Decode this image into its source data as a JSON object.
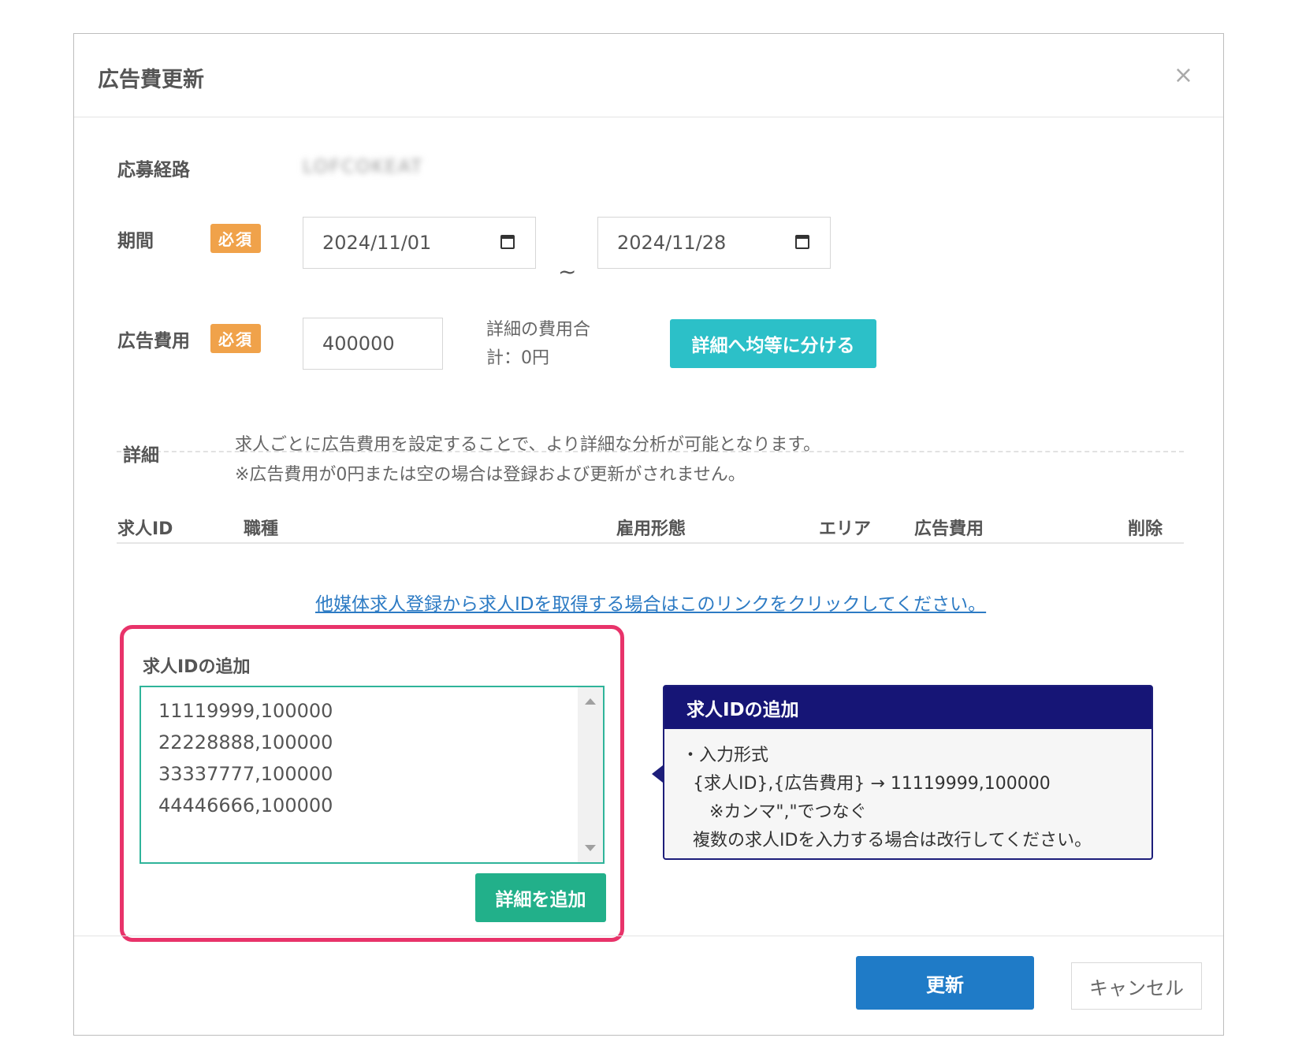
{
  "dialog": {
    "title": "広告費更新",
    "close_label": "×"
  },
  "form": {
    "route_label": "応募経路",
    "route_value": "LOFCOKEAT",
    "period_label": "期間",
    "required_badge": "必須",
    "start_date": "2024/11/01",
    "end_date": "2024/11/28",
    "range_separator": "~",
    "cost_label": "広告費用",
    "cost_value": "400000",
    "detail_sum_line1": "詳細の費用合",
    "detail_sum_line2": "計：0円",
    "split_button": "詳細へ均等に分ける"
  },
  "details": {
    "label": "詳細",
    "desc_line1": "求人ごとに広告費用を設定することで、より詳細な分析が可能となります。",
    "desc_line2": "※広告費用が0円または空の場合は登録および更新がされません。",
    "columns": [
      "求人ID",
      "職種",
      "雇用形態",
      "エリア",
      "広告費用",
      "削除"
    ],
    "link_text": "他媒体求人登録から求人IDを取得する場合はこのリンクをクリックしてください。"
  },
  "add_ids": {
    "title": "求人IDの追加",
    "lines": [
      "11119999,100000",
      "22228888,100000",
      "33337777,100000",
      "44446666,100000"
    ],
    "add_button": "詳細を追加"
  },
  "tooltip": {
    "title": "求人IDの追加",
    "line1": "・入力形式",
    "line2": "  {求人ID},{広告費用} → 11119999,100000",
    "line3": "     ※カンマ\",\"でつなぐ",
    "line4": "  複数の求人IDを入力する場合は改行してください。"
  },
  "footer": {
    "update_button": "更新",
    "cancel_button": "キャンセル"
  }
}
